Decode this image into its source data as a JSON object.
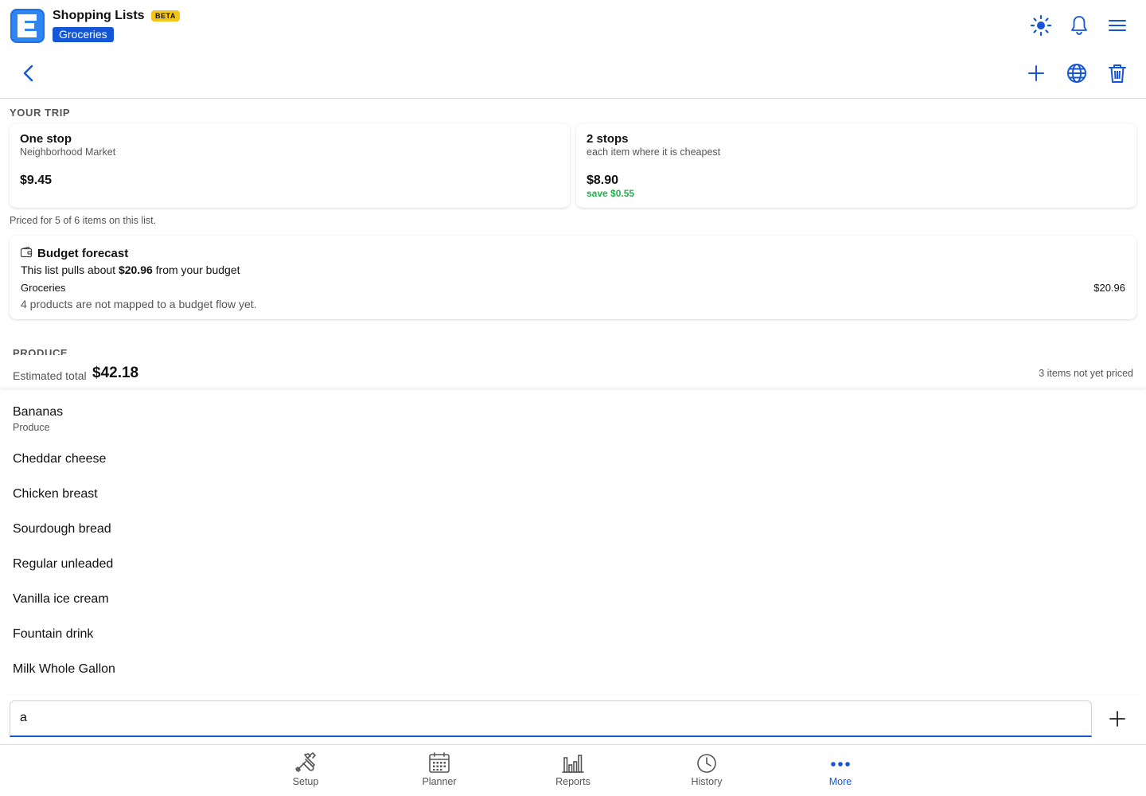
{
  "header": {
    "app_title": "Shopping Lists",
    "beta": "BETA",
    "list_name": "Groceries"
  },
  "trip": {
    "section_label": "YOUR TRIP",
    "options": [
      {
        "title": "One stop",
        "subtitle": "Neighborhood Market",
        "price": "$9.45",
        "save": ""
      },
      {
        "title": "2 stops",
        "subtitle": "each item where it is cheapest",
        "price": "$8.90",
        "save": "save $0.55"
      }
    ],
    "priced_note": "Priced for 5 of 6 items on this list."
  },
  "budget": {
    "title": "Budget forecast",
    "pull_prefix": "This list pulls about ",
    "pull_amount": "$20.96",
    "pull_suffix": " from your budget",
    "category": "Groceries",
    "category_amount": "$20.96",
    "unmapped_note": "4 products are not mapped to a budget flow yet."
  },
  "produce_label": "PRODUCE",
  "estimate": {
    "label": "Estimated total",
    "value": "$42.18",
    "not_priced": "3 items not yet priced"
  },
  "suggestions": [
    {
      "name": "Bananas",
      "category": "Produce"
    },
    {
      "name": "Cheddar cheese"
    },
    {
      "name": "Chicken breast"
    },
    {
      "name": "Sourdough bread"
    },
    {
      "name": "Regular unleaded"
    },
    {
      "name": "Vanilla ice cream"
    },
    {
      "name": "Fountain drink"
    },
    {
      "name": "Milk Whole Gallon"
    }
  ],
  "input": {
    "value": "a"
  },
  "nav": [
    {
      "label": "Setup",
      "icon": "tools-icon"
    },
    {
      "label": "Planner",
      "icon": "calendar-icon"
    },
    {
      "label": "Reports",
      "icon": "bar-chart-icon"
    },
    {
      "label": "History",
      "icon": "clock-icon"
    },
    {
      "label": "More",
      "icon": "more-dots-icon",
      "active": true
    }
  ],
  "colors": {
    "accent": "#1556d6",
    "badge": "#f5c518",
    "save_green": "#22b14c"
  }
}
